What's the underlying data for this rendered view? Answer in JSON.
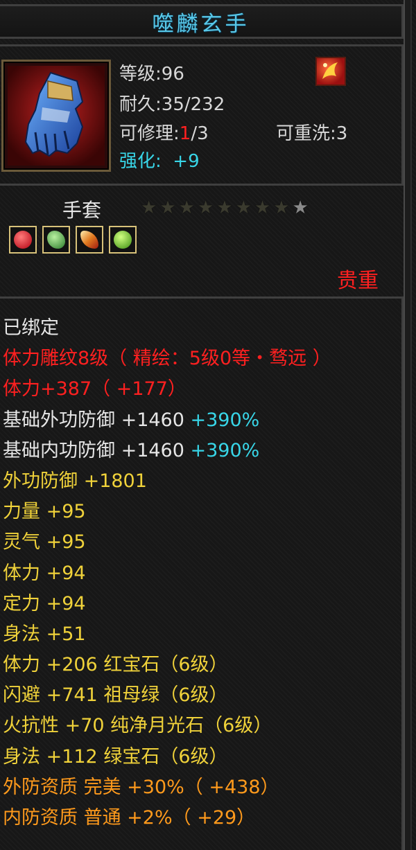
{
  "item": {
    "name": "噬麟玄手",
    "level_label": "等级",
    "level_value": "96",
    "durability_label": "耐久",
    "durability_value": "35/232",
    "repair_label": "可修理",
    "repair_current": "1",
    "repair_max": "/3",
    "rewash_label": "可重洗",
    "rewash_value": "3",
    "enhance_label": "强化:",
    "enhance_value": "+9",
    "type": "手套",
    "stars_total": 9,
    "stars_lit": 1,
    "rarity": "贵重",
    "gem_icons": [
      "red-gem-icon",
      "green-gem-icon",
      "orange-gem-icon",
      "emerald-gem-icon"
    ]
  },
  "attributes": [
    {
      "text": "已绑定",
      "color": "white"
    },
    {
      "text": "体力雕纹8级（ 精绘：5级0等・骛远 ）",
      "color": "red"
    },
    {
      "text": "体力+387（ +177）",
      "color": "red"
    },
    {
      "text": "基础外功防御 +1460",
      "extra": " +390%",
      "color": "pale"
    },
    {
      "text": "基础内功防御 +1460",
      "extra": " +390%",
      "color": "pale"
    },
    {
      "text": "外功防御 +1801",
      "color": "yellow"
    },
    {
      "text": "力量 +95",
      "color": "yellow"
    },
    {
      "text": "灵气 +95",
      "color": "yellow"
    },
    {
      "text": "体力 +94",
      "color": "yellow"
    },
    {
      "text": "定力 +94",
      "color": "yellow"
    },
    {
      "text": "身法 +51",
      "color": "yellow"
    },
    {
      "text": "体力 +206 红宝石（6级）",
      "color": "yellow"
    },
    {
      "text": "闪避 +741 祖母绿（6级）",
      "color": "yellow"
    },
    {
      "text": "火抗性 +70 纯净月光石（6级）",
      "color": "yellow"
    },
    {
      "text": "身法 +112 绿宝石（6级）",
      "color": "yellow"
    },
    {
      "text": "外防资质  完美 +30%（ +438）",
      "color": "orange"
    },
    {
      "text": "内防资质  普通 +2%（ +29）",
      "color": "orange"
    }
  ],
  "colors": {
    "title": "#58c8e8",
    "cyan": "#38d6e8",
    "red": "#ff2020",
    "yellow": "#f0d23a",
    "orange": "#ff9a1c"
  }
}
